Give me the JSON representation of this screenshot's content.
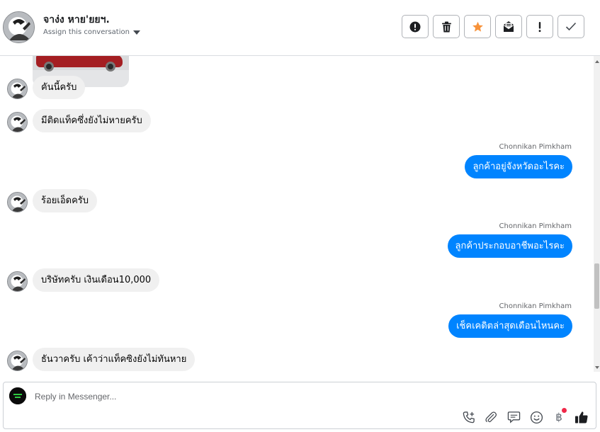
{
  "header": {
    "contact_name": "จาง่ง หาย'ยยฯ.",
    "assign_label": "Assign this conversation",
    "actions": [
      {
        "name": "report-spam",
        "icon": "alert-circle-icon"
      },
      {
        "name": "delete",
        "icon": "trash-icon"
      },
      {
        "name": "star",
        "icon": "star-icon",
        "color": "#f7923a"
      },
      {
        "name": "mark-unread",
        "icon": "envelope-open-icon"
      },
      {
        "name": "flag-important",
        "icon": "exclamation-icon"
      },
      {
        "name": "mark-done",
        "icon": "checkmark-icon"
      }
    ]
  },
  "messages": [
    {
      "dir": "in",
      "text": "คันนี้ครับ"
    },
    {
      "dir": "in",
      "text": "มีติดแท็คซึ่งยังไม่หายครับ"
    },
    {
      "dir": "out",
      "sender": "Chonnikan Pimkham",
      "text": "ลูกค้าอยู่จังหวัดอะไรคะ"
    },
    {
      "dir": "in",
      "text": "ร้อยเอ็ดครับ"
    },
    {
      "dir": "out",
      "sender": "Chonnikan Pimkham",
      "text": "ลูกค้าประกอบอาชีพอะไรคะ"
    },
    {
      "dir": "in",
      "text": "บริษัทครับ เงินเดือน10,000"
    },
    {
      "dir": "out",
      "sender": "Chonnikan Pimkham",
      "text": "เช็คเคดิตล่าสุดเดือนไหนคะ"
    },
    {
      "dir": "in",
      "text": "ธันวาครับ เค้าว่าแท็คซิงยังไม่ทันหาย"
    }
  ],
  "composer": {
    "placeholder": "Reply in Messenger...",
    "tools": [
      "phone-plus-icon",
      "paperclip-icon",
      "chat-bubble-icon",
      "smiley-icon",
      "baht-icon",
      "thumbs-up-icon"
    ],
    "baht_symbol": "฿"
  },
  "colors": {
    "outgoing_bubble": "#0084ff",
    "incoming_bubble": "#f0f0f0",
    "star": "#f7923a",
    "notification_dot": "#f02849"
  }
}
